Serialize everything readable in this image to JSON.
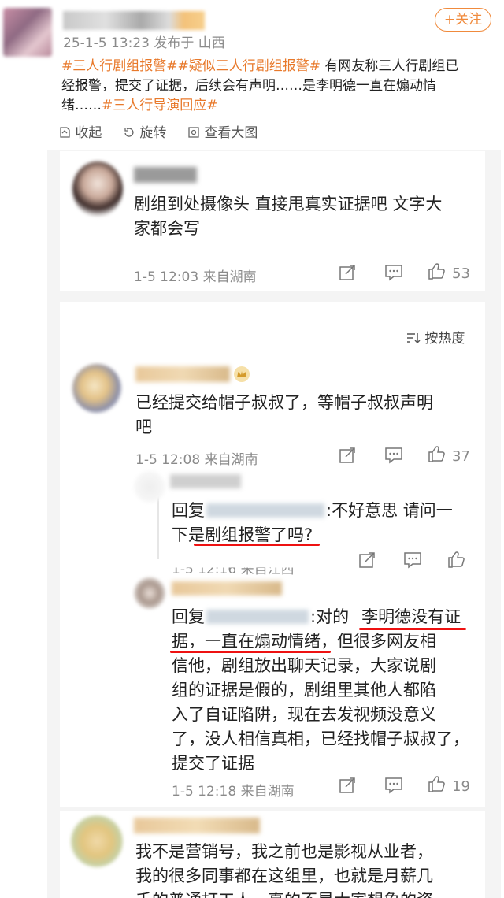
{
  "post": {
    "meta": "25-1-5 13:23 发布于 山西",
    "follow_label": "+关注",
    "content_parts": [
      {
        "type": "tag",
        "text": "#三人行剧组报警#"
      },
      {
        "type": "tag",
        "text": "#疑似三人行剧组报警#"
      },
      {
        "type": "text",
        "text": " 有网友称三人行剧组已经报警，提交了证据，后续会有声明……是李明德一直在煽动情绪……"
      },
      {
        "type": "tag",
        "text": "#三人行导演回应#"
      }
    ],
    "line1_tag1": "#三人行剧组报警#",
    "line1_tag2": "#疑似三人行剧组报警#",
    "line1_text": "有网友称三人行剧组已",
    "line2_text": "经报警，提交了证据，后续会有声明……是李明德一直在煽动情",
    "line3_text": "绪……",
    "line3_tag": "#三人行导演回应#",
    "actions": {
      "collect": "收起",
      "retweet": "旋转",
      "view_large": "查看大图"
    }
  },
  "comments": [
    {
      "text": "剧组到处摄像头 直接甩真实证据吧 文字大家都会写",
      "line1": "剧组到处摄像头 直接甩真实证据吧 文字大",
      "line2": "家都会写",
      "meta": "1-5 12:03 来自湖南",
      "likes": "53"
    },
    {
      "sort_label": "按热度",
      "text": "已经提交给帽子叔叔了，等帽子叔叔声明吧",
      "line1": "已经提交给帽子叔叔了，等帽子叔叔声明",
      "line2": "吧",
      "meta": "1-5 12:08 来自湖南",
      "likes": "37",
      "replies": [
        {
          "prefix": "回复",
          "suffix": ":不好意思 请问一",
          "line2": "下是剧组报警了吗?",
          "meta": "1-5 12:16 来自江西",
          "likes": ""
        },
        {
          "prefix": "回复",
          "suffix": ":对的",
          "highlight1": "李明德没有证",
          "line2": "据，一直在煽动情绪，但很多网友相",
          "line3": "信他，剧组放出聊天记录，大家说剧",
          "line4": "组的证据是假的，剧组里其他人都陷",
          "line5": "入了自证陷阱，现在去发视频没意义",
          "line6": "了，没人相信真相，已经找帽子叔叔了，",
          "line7": "提交了证据",
          "meta": "1-5 12:18 来自湖南",
          "likes": "19"
        }
      ]
    },
    {
      "line1": "我不是营销号，我之前也是影视从业者，",
      "line2": "我的很多同事都在这组里，也就是月薪几",
      "line3": "千的普通打工人，真的不是大家想象的资"
    }
  ],
  "colors": {
    "hashtag": "#e8792b",
    "underline": "#e11111",
    "meta": "#8a8a8a"
  }
}
